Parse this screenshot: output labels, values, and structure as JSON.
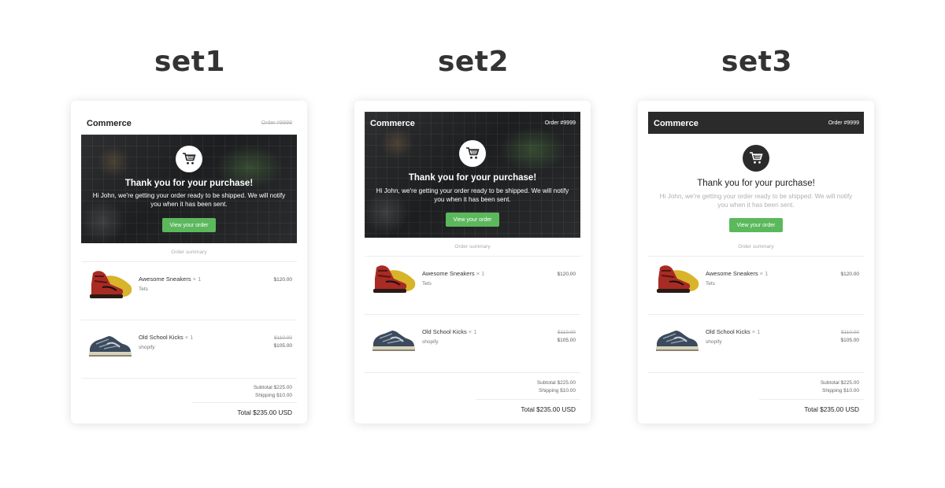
{
  "set_titles": [
    "set1",
    "set2",
    "set3"
  ],
  "email": {
    "brand": "Commerce",
    "order_number": "Order #9999",
    "hero_title": "Thank you for your purchase!",
    "hero_message": "Hi John, we're getting your order ready to be shipped. We will notify you when it has been sent.",
    "button_label": "View your order",
    "summary_label": "Order summary",
    "items": [
      {
        "name": "Awesome Sneakers",
        "qty": "× 1",
        "vendor": "Tets",
        "price": "$120.00",
        "old_price": "",
        "icon": "red-high-top-sneaker-image"
      },
      {
        "name": "Old School Kicks",
        "qty": "× 1",
        "vendor": "shopify",
        "price": "$105.00",
        "old_price": "$110.00",
        "icon": "navy-running-shoe-image"
      }
    ],
    "subtotal": "Subtotal $225.00",
    "shipping": "Shipping $10.00",
    "total": "Total $235.00 USD"
  },
  "colors": {
    "button": "#5cb85c",
    "dark_header": "#2b2b2b",
    "card_bg": "#ffffff"
  }
}
